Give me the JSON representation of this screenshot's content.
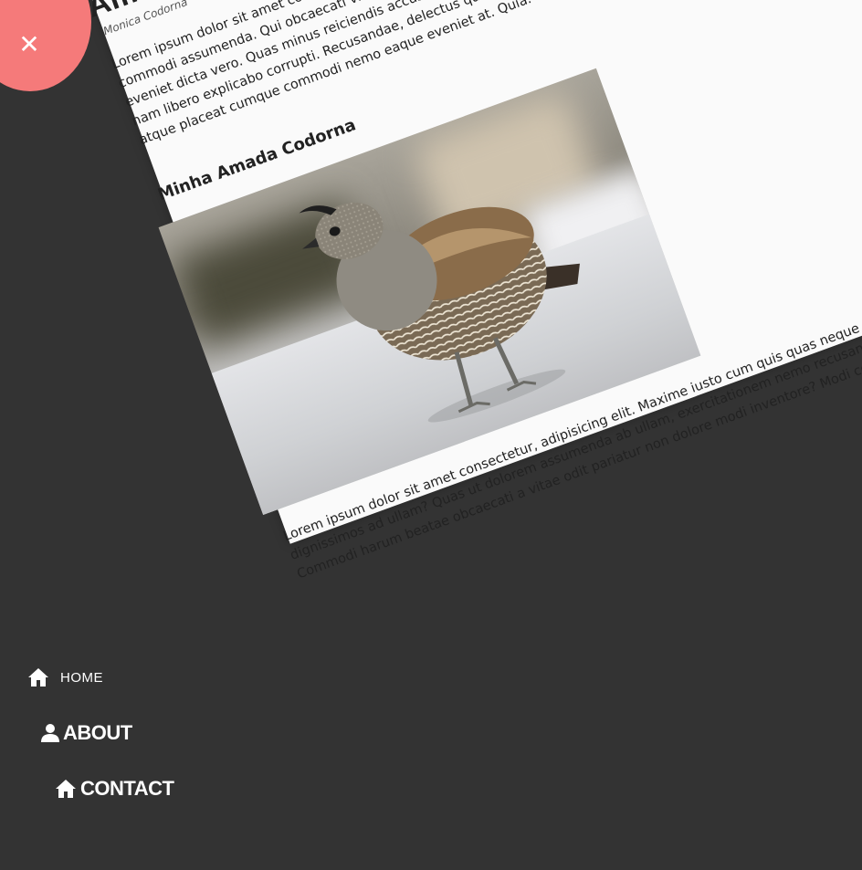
{
  "close_button": {
    "symbol": "✕",
    "color": "#f57a7a"
  },
  "nav": {
    "home": {
      "label": "HOME",
      "icon": "home-icon"
    },
    "about": {
      "label": "ABOUT",
      "icon": "user-icon"
    },
    "contact": {
      "label": "CONTACT",
      "icon": "home-icon"
    }
  },
  "article": {
    "title": "Amazing Article",
    "author": "Monica Codorna",
    "paragraph1": "Lorem ipsum dolor sit amet consectetur adipisicing elit. Repellendus quidem dolorum, voluptatem quam aut ex quae quas totam veniam et nihil ullam maiores libero commodi assumenda. Qui obcaecati vitae blanditiis, eos repudiandae! Aliquid dignissimos molestiae commodi accusamus dolorum aut. Laboriosam laborum non pariatur eveniet dicta vero. Quas minus reiciendis accusamus dolorum aut explicabo corrupti debitis animi ipsum voluptatibus quisquam ut neque quam quis distinctio mollitia nam libero explicabo corrupti. Recusandae, delectus quos similique fugiat rem, dolor totam culpa sunt cupiditate laboriosam dolores architecto quasi consequuntur ipsum atque placeat cumque commodi nemo eaque eveniet at. Quia.",
    "subtitle": "Minha Amada Codorna",
    "image_alt": "quail photo",
    "paragraph2": "Lorem ipsum dolor sit amet consectetur, adipisicing elit. Maxime iusto cum quis quas neque eos eveniet voluptatum, laudantium numquam commodi debitis quasi soluta dignissimos ad ullam? Quas ut dolorem assumenda ab ullam, exercitationem nemo recusandae consectetur, molestias nisi omnis perspiciatis rem fugit minus enim. Commodi harum beatae obcaecati a vitae odit pariatur non dolore modi inventore? Modi consequatur reiciendis labore repellat eaque alias laboriosam ad voluptatibus."
  }
}
